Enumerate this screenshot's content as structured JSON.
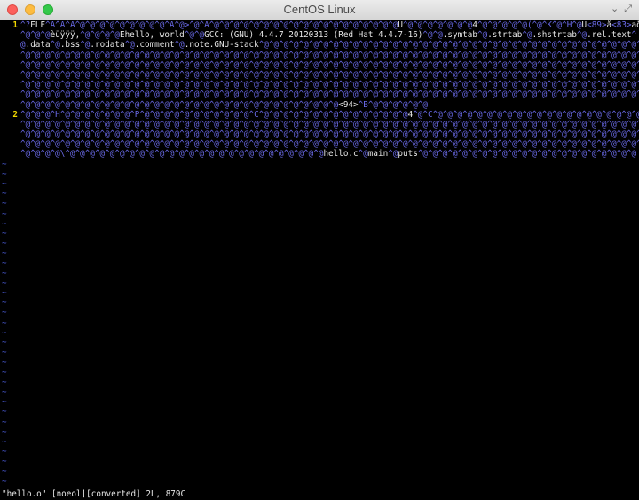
{
  "window": {
    "title": "CentOS Linux",
    "controls": [
      "chevron-down-icon",
      "expand-icon"
    ]
  },
  "editor": {
    "lines": [
      {
        "number": "1",
        "rows": [
          [
            {
              "t": "c",
              "s": "^?"
            },
            {
              "t": "x",
              "s": "ELF"
            },
            {
              "t": "c",
              "s": "^A^A^A^@^@^@^@^@^@^@^@^@^A^@>^@^A^@^@^@^@^@^@^@^@^@^@^@^@^@^@^@^@^@^@^@"
            },
            {
              "t": "x",
              "s": "U"
            },
            {
              "t": "c",
              "s": "^@^@^@^@^@^@^@"
            },
            {
              "t": "x",
              "s": "4"
            },
            {
              "t": "c",
              "s": "^@^@^@^@^@(^@^K^@^H^@"
            },
            {
              "t": "x",
              "s": "U"
            },
            {
              "t": "c",
              "s": "<89>"
            },
            {
              "t": "x",
              "s": "å"
            },
            {
              "t": "c",
              "s": "<83>"
            },
            {
              "t": "x",
              "s": "aðì"
            },
            {
              "t": "c",
              "s": "<83>"
            },
            {
              "t": "x",
              "s": "ì^P"
            },
            {
              "t": "c",
              "s": "Ç"
            },
            {
              "t": "x",
              "s": "^D$"
            },
            {
              "t": "c",
              "s": "^@"
            }
          ],
          [
            {
              "t": "c",
              "s": "^@^@^@"
            },
            {
              "t": "x",
              "s": "èüÿÿÿ,"
            },
            {
              "t": "c",
              "s": "^@^@^@^@"
            },
            {
              "t": "x",
              "s": "Ëhello, world"
            },
            {
              "t": "c",
              "s": "^@^@"
            },
            {
              "t": "x",
              "s": "GCC: (GNU) 4.4.7 20120313 (Red Hat 4.4.7-16)"
            },
            {
              "t": "c",
              "s": "^@^@"
            },
            {
              "t": "x",
              "s": ".symtab"
            },
            {
              "t": "c",
              "s": "^@"
            },
            {
              "t": "x",
              "s": ".strtab"
            },
            {
              "t": "c",
              "s": "^@"
            },
            {
              "t": "x",
              "s": ".shstrtab"
            },
            {
              "t": "c",
              "s": "^@"
            },
            {
              "t": "x",
              "s": ".rel.text"
            },
            {
              "t": "c",
              "s": "^"
            }
          ],
          [
            {
              "t": "c",
              "s": "@"
            },
            {
              "t": "x",
              "s": ".data"
            },
            {
              "t": "c",
              "s": "^@"
            },
            {
              "t": "x",
              "s": ".bss"
            },
            {
              "t": "c",
              "s": "^@"
            },
            {
              "t": "x",
              "s": ".rodata"
            },
            {
              "t": "c",
              "s": "^@"
            },
            {
              "t": "x",
              "s": ".comment"
            },
            {
              "t": "c",
              "s": "^@"
            },
            {
              "t": "x",
              "s": ".note.GNU-stack"
            },
            {
              "t": "c",
              "s": "^@^@^@^@^@^@^@^@^@^@^@^@^@^@^@^@^@^@^@^@^@^@^@^@^@^@^@^@^@^@^@^@^@^@^@^@^@^@^@^@^@^@^@^@^@^@"
            }
          ],
          [
            {
              "t": "c",
              "s": "^@^@^@^@^@^@^@^@^@^@^@^@^@^@^@^@^@^@^@^@^@^@^@^@^@^@^@^@^@^@^@^@^@^@^@^@^@^@^@^@^@^@^@^@^@^@^@^@^@^@^@^@^@^@^@^@^@^@^@^@^@^@^@^@"
            }
          ],
          [
            {
              "t": "c",
              "s": "^@^@^@^@^@^@^@^@^@^@^@^@^@^@^@^@^@^@^@^@^@^@^@^@^@^@^@^@^@^@^@^@^@^@^@^@^@^@^@^@^@^@^@^@^@^@^@^@^@^@^@^@^@^@^@^@^@^@^@^@^@^@^@^@"
            }
          ],
          [
            {
              "t": "c",
              "s": "^@^@^@^@^@^@^@^@^@^@^@^@^@^@^@^@^@^@^@^@^@^@^@^@^@^@^@^@^@^@^@^@^@^@^@^@^@^@^@^@^@^@^@^@^@^@^@^@^@^@^@^@^@^@^@^@^@^@^@^@^@^@^@^@"
            }
          ],
          [
            {
              "t": "c",
              "s": "^@^@^@^@^@^@^@^@^@^@^@^@^@^@^@^@^@^@^@^@^@^@^@^@^@^@^@^@^@^@^@^@^@^@^@^@^@^@^@^@^@^@^@^@^@^@^@^@^@^@^@^@^@^@^@^@^@^@^@^@^@^@^@^@"
            }
          ],
          [
            {
              "t": "c",
              "s": "^@^@^@^@^@^@^@^@^@^@^@^@^@^@^@^@^@^@^@^@^@^@^@^@^@^@^@^@^@^@^@^@^@^@^@^@^@^@^@^@^@^@^@^@^@^@^@^@^@^@^@^@^@^@^@^@^@^@^@^@^@^@^@^@"
            }
          ],
          [
            {
              "t": "c",
              "s": "^@^@^@^@^@^@^@^@^@^@^@^@^@^@^@^@^@^@^@^@^@^@^@^@^@^@^@^@^@^@^@^@"
            },
            {
              "t": "x",
              "s": "<94>"
            },
            {
              "t": "c",
              "s": "^B^@^@^@^@^@^@"
            }
          ]
        ]
      },
      {
        "number": "2",
        "rows": [
          [
            {
              "t": "c",
              "s": "^@^@^@^H^@^@^@^@^@^@^@^P^@^@^@^@^@^@^@^@^@^@^@^C^@^@^@^@^@^@^@^@^@^@^@^@^@^@^@"
            },
            {
              "t": "x",
              "s": "4"
            },
            {
              "t": "c",
              "s": "^@^C^@^@^@^@^@^@^@^@^@^@^@^@^@^@^@^@^@^@^@^@^@^@^@^@^@^@^@^@^@^@^@^@^@^@"
            }
          ],
          [
            {
              "t": "c",
              "s": "^@^@^@^@^@^@^@^@^@^@^@^@^@^@^@^@^@^@^@^@^@^@^@^@^@^@^@^@^@^@^@^@^@^@^@^@^@^@^@^@^@^@^@^@^@^@^@^@^@^@^@^@^@^@^@^@^@^@^@^@^@^@^@^@"
            }
          ],
          [
            {
              "t": "c",
              "s": "^@^@^@^@^@^@^@^@^@^@^@^@^@^@^@^@^@^@^@^@^@^@^@^@^@^@^@^@^@^@^@^@^@^@^@^@^@^@^@^@^@^@^@^@^@^@^@^@^@^@^@^@^@^@^@^@^@^@^@^@^@^@^@^@"
            }
          ],
          [
            {
              "t": "c",
              "s": "^@^@^@^@^@^@^@^@^@^@^@^@^@^@^@^@^@^@^@^@^@^@^@^@^@^@^@^@^@^@^@^@^@^@^@^@^@^@^@^@^@^@^@^@^@^@^@^@^@^@^@^@^@^@^@^@^@^@^@^@^@^@^@^@"
            }
          ],
          [
            {
              "t": "c",
              "s": "^@^@^@^@\\^@^@^@^@^@^@^@^@^@^@^@^@^@^@^@^@^@^@^@^@^@^@^@^@^@^@"
            },
            {
              "t": "x",
              "s": "hello.c"
            },
            {
              "t": "c",
              "s": "^@"
            },
            {
              "t": "x",
              "s": "main"
            },
            {
              "t": "c",
              "s": "^@"
            },
            {
              "t": "x",
              "s": "puts"
            },
            {
              "t": "c",
              "s": "^@^@^@^@^@^@^@^@^@^@^@^@^@^@^@^@^@^@^@^@^@^@"
            }
          ]
        ]
      }
    ],
    "tilde": "~",
    "tilde_rows": 33
  },
  "status_line": "\"hello.o\" [noeol][converted] 2L, 879C"
}
